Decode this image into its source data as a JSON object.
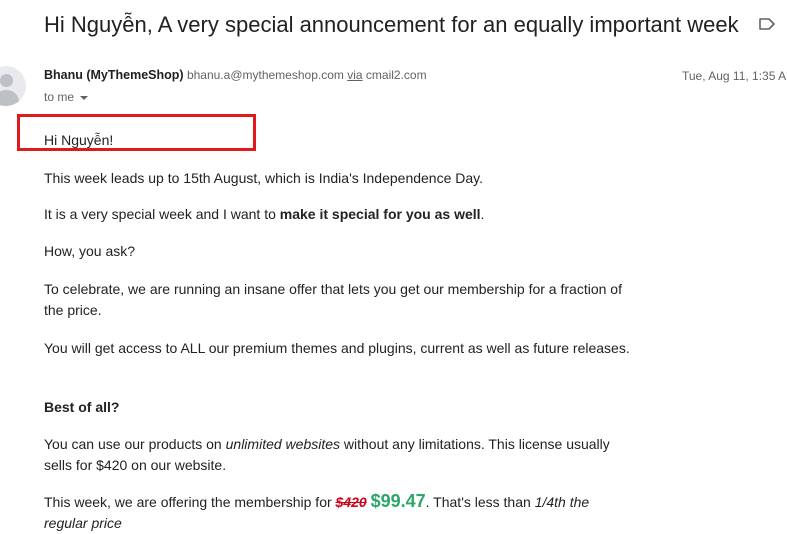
{
  "email": {
    "subject": "Hi Nguyễn, A very special announcement for an equally important week",
    "sender": {
      "name": "Bhanu (MyThemeShop)",
      "email": "bhanu.a@mythemeshop.com",
      "via_label": "via",
      "via_domain": "cmail2.com"
    },
    "recipient_label": "to me",
    "date": "Tue, Aug 11, 1:35 A"
  },
  "body": {
    "greeting": "Hi Nguyễn!",
    "p1": "This week leads up to 15th August, which is India's Independence Day.",
    "p2_before": "It is a very special week and I want to ",
    "p2_bold": "make it special for you as well",
    "p2_after": ".",
    "p3": "How, you ask?",
    "p4": "To celebrate, we are running an insane offer that lets you get our membership for a fraction of the price.",
    "p5": "You will get access to ALL our premium themes and plugins, current as well as future releases.",
    "p6": "Best of all?",
    "p7_before": "You can use our products on ",
    "p7_italic": "unlimited websites",
    "p7_after": " without any limitations. This license usually sells for $420 on our website.",
    "p8_before": "This week, we are offering the membership for ",
    "p8_old_price": "$420",
    "p8_new_price": "$99.47",
    "p8_mid": ". That's less than ",
    "p8_italic": "1/4th the regular price"
  },
  "colors": {
    "highlight_box": "#e0191f",
    "old_price": "#d0021b",
    "new_price": "#2da66a"
  },
  "icons": {
    "label": "label-arrow-icon",
    "avatar": "default-avatar-icon",
    "recipient_dropdown": "chevron-down-icon"
  }
}
